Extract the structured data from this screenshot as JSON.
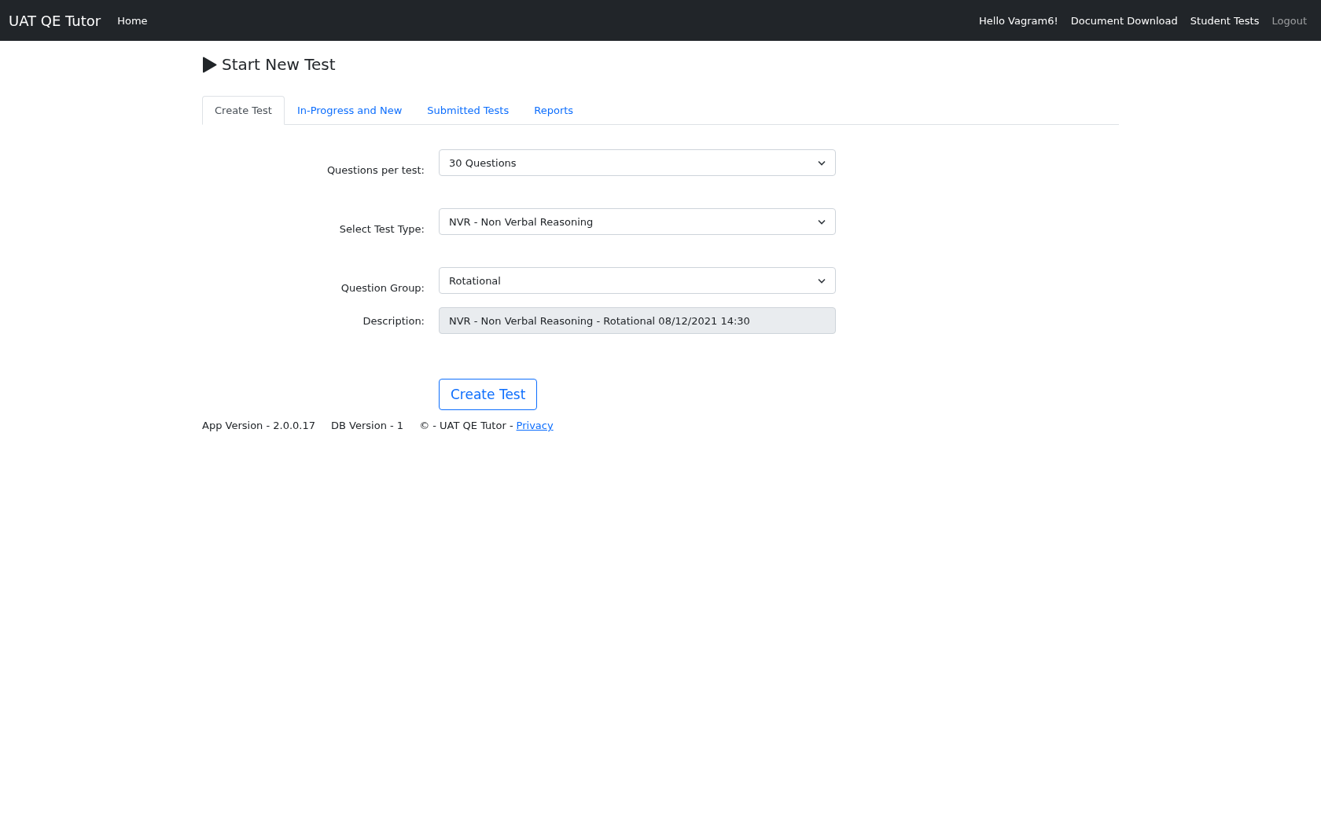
{
  "navbar": {
    "brand": "UAT QE Tutor",
    "links": [
      "Home"
    ],
    "right_links": [
      {
        "label": "Hello Vagram6!",
        "muted": false
      },
      {
        "label": "Document Download",
        "muted": false
      },
      {
        "label": "Student Tests",
        "muted": false
      },
      {
        "label": "Logout",
        "muted": true
      }
    ]
  },
  "heading": "Start New Test",
  "tabs": [
    {
      "label": "Create Test",
      "selected": true
    },
    {
      "label": "In-Progress and New",
      "selected": false
    },
    {
      "label": "Submitted Tests",
      "selected": false
    },
    {
      "label": "Reports",
      "selected": false
    }
  ],
  "form": [
    {
      "label": "Questions per test:",
      "kind": "select",
      "value": "30 Questions"
    },
    {
      "label": "Select Test Type:",
      "kind": "select",
      "value": "NVR - Non Verbal Reasoning"
    },
    {
      "label": "Question Group:",
      "kind": "select",
      "value": "Rotational"
    },
    {
      "label": "Description:",
      "kind": "readonly",
      "value": "NVR - Non Verbal Reasoning - Rotational 08/12/2021  14:30"
    }
  ],
  "submit_button": "Create Test",
  "footer": {
    "app_version": "App Version - 2.0.0.17",
    "db_version": "DB Version - 1",
    "copyright": "© - UAT QE Tutor -",
    "privacy_link": "Privacy"
  }
}
